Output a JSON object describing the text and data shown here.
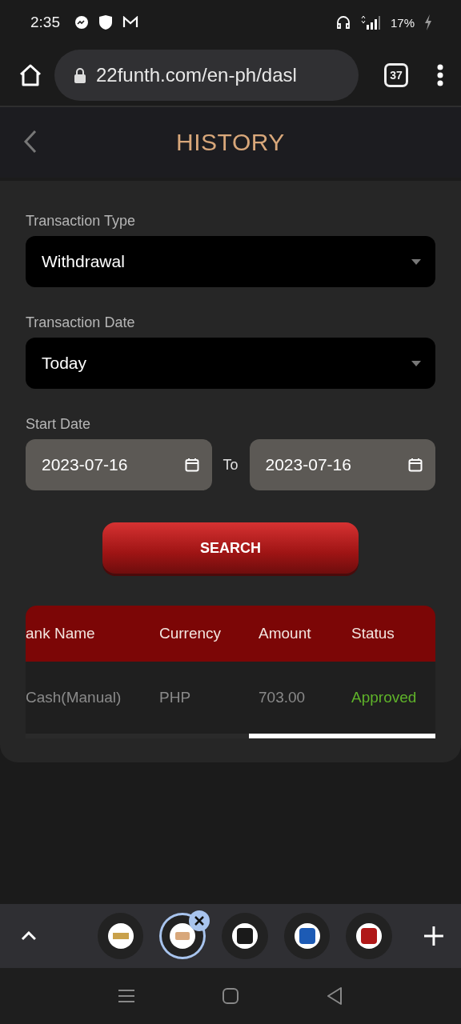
{
  "status_bar": {
    "time": "2:35",
    "battery": "17%"
  },
  "browser": {
    "url": "22funth.com/en-ph/dasl",
    "tab_count": "37"
  },
  "header": {
    "title": "HISTORY"
  },
  "form": {
    "fields": [
      {
        "label": "Transaction Type",
        "value": "Withdrawal"
      },
      {
        "label": "Transaction Date",
        "value": "Today"
      }
    ],
    "date_range": {
      "label": "Start Date",
      "start": "2023-07-16",
      "separator": "To",
      "end": "2023-07-16"
    },
    "search_button": "SEARCH"
  },
  "table": {
    "columns": [
      "ank Name",
      "Currency",
      "Amount",
      "Status"
    ],
    "rows": [
      {
        "cells": [
          "Cash(Manual)",
          "PHP",
          "703.00",
          "Approved"
        ],
        "color": "#5fb32a"
      }
    ]
  },
  "tab_strip": {
    "tabs": [
      {
        "selected": false
      },
      {
        "selected": true
      },
      {
        "selected": false
      },
      {
        "selected": false
      },
      {
        "selected": false
      }
    ]
  }
}
